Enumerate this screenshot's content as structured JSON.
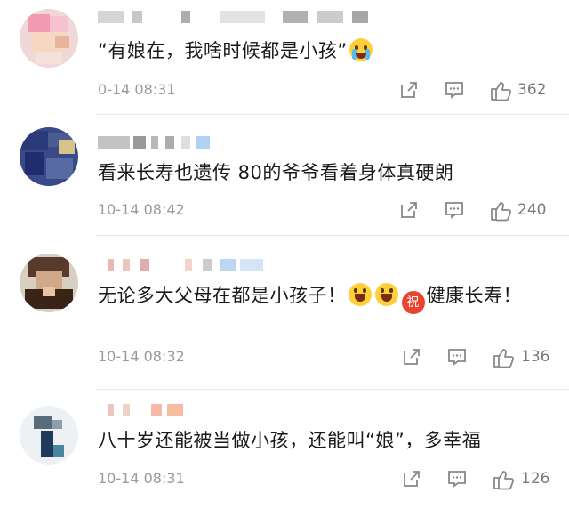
{
  "comments": [
    {
      "text": "“有娘在，我啥时候都是小孩”",
      "time": "0-14 08:31",
      "likes": "362",
      "emoji_after": "crying-face-icon"
    },
    {
      "text": "看来长寿也遗传 80的爷爷看着身体真硬朗",
      "time": "10-14 08:42",
      "likes": "240"
    },
    {
      "text_before": "无论多大父母在都是小孩子！",
      "zhu_char": "祝",
      "text_after": "健康长寿！",
      "time": "10-14 08:32",
      "likes": "136"
    },
    {
      "text": "八十岁还能被当做小孩，还能叫“娘”，多幸福",
      "time": "10-14 08:31",
      "likes": "126"
    }
  ],
  "colors": {
    "meta_gray": "#9a9a9a",
    "icon_gray": "#888888",
    "divider": "#e8e8e8",
    "emoji_yellow": "#ffcf3a",
    "zhu_red": "#e8442f"
  }
}
